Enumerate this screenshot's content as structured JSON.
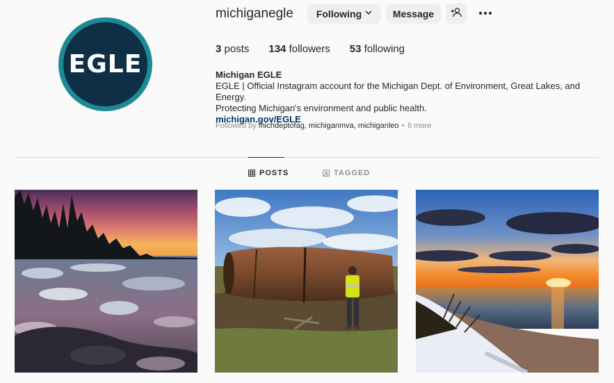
{
  "profile": {
    "username": "michiganegle",
    "avatar_logo_text": "EGLE",
    "following_button": "Following",
    "message_button": "Message",
    "suggest_icon": "person-plus-icon",
    "more_icon": "more-options-icon"
  },
  "stats": {
    "posts_count": "3",
    "posts_label": "posts",
    "followers_count": "134",
    "followers_label": "followers",
    "following_count": "53",
    "following_label": "following"
  },
  "bio": {
    "name": "Michigan EGLE",
    "line1": "EGLE | Official Instagram account for the Michigan Dept. of Environment, Great Lakes, and Energy.",
    "line2": "Protecting Michigan's environment and public health.",
    "link": "michigan.gov/EGLE",
    "followed_by_prefix": "Followed by ",
    "followed_by_names": "michdeptofag, michiganmva, michiganleo",
    "followed_by_more": " + 6 more"
  },
  "tabs": {
    "posts": "POSTS",
    "tagged": "TAGGED",
    "active": "posts"
  },
  "colors": {
    "avatar_ring": "#1c8a96",
    "avatar_bg": "#0e2f45",
    "link": "#00376b",
    "muted": "#8e8e8e"
  }
}
